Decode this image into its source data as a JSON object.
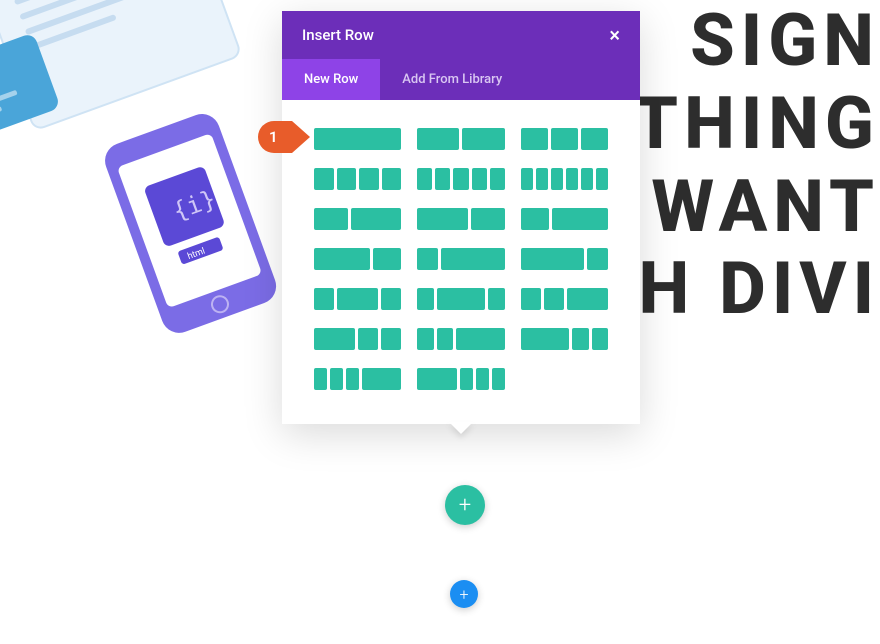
{
  "bg_text": "SIGN\nTHING\n WANT\nH DIVI",
  "marker": {
    "number": "1"
  },
  "modal": {
    "title": "Insert Row",
    "tabs": {
      "new_row": "New Row",
      "add_library": "Add From Library"
    }
  },
  "buttons": {
    "add_row": "+",
    "add_section": "+"
  },
  "layouts": [
    {
      "name": "1col",
      "cols": [
        "w-100"
      ]
    },
    {
      "name": "2col",
      "cols": [
        "w-50",
        "w-50"
      ]
    },
    {
      "name": "3col",
      "cols": [
        "w-33",
        "w-33",
        "w-33"
      ]
    },
    {
      "name": "4col",
      "cols": [
        "w-25",
        "w-25",
        "w-25",
        "w-25"
      ]
    },
    {
      "name": "5col",
      "cols": [
        "w-20",
        "w-20",
        "w-20",
        "w-20",
        "w-20"
      ]
    },
    {
      "name": "6col",
      "cols": [
        "w-16",
        "w-16",
        "w-16",
        "w-16",
        "w-16",
        "w-16"
      ]
    },
    {
      "name": "2-5col",
      "cols": [
        "w-40",
        "w-60"
      ]
    },
    {
      "name": "3-5col",
      "cols": [
        "w-60",
        "w-40"
      ]
    },
    {
      "name": "1-3-2-3",
      "cols": [
        "w-33",
        "w-66"
      ]
    },
    {
      "name": "2-3-1-3",
      "cols": [
        "w-66",
        "w-33"
      ]
    },
    {
      "name": "1-4-3-4",
      "cols": [
        "w-25",
        "w-75"
      ]
    },
    {
      "name": "3-4-1-4",
      "cols": [
        "w-75",
        "w-25"
      ]
    },
    {
      "name": "1-4-1-2-1-4",
      "cols": [
        "w-25",
        "w-50",
        "w-25"
      ]
    },
    {
      "name": "1-5-3-5-1-5",
      "cols": [
        "w-20",
        "w-60",
        "w-20"
      ]
    },
    {
      "name": "1-4-1-4-1-2",
      "cols": [
        "w-25",
        "w-25",
        "w-50"
      ]
    },
    {
      "name": "1-2-1-4-1-4",
      "cols": [
        "w-50",
        "w-25",
        "w-25"
      ]
    },
    {
      "name": "1-5-1-5-3-5",
      "cols": [
        "w-20",
        "w-20",
        "w-60"
      ]
    },
    {
      "name": "3-5-1-5-1-5",
      "cols": [
        "w-60",
        "w-20",
        "w-20"
      ]
    },
    {
      "name": "1-6-1-6-1-6-1-2",
      "cols": [
        "w-16",
        "w-16",
        "w-16",
        "w-50"
      ]
    },
    {
      "name": "1-2-1-6-1-6-1-6",
      "cols": [
        "w-50",
        "w-16",
        "w-16",
        "w-16"
      ]
    }
  ]
}
